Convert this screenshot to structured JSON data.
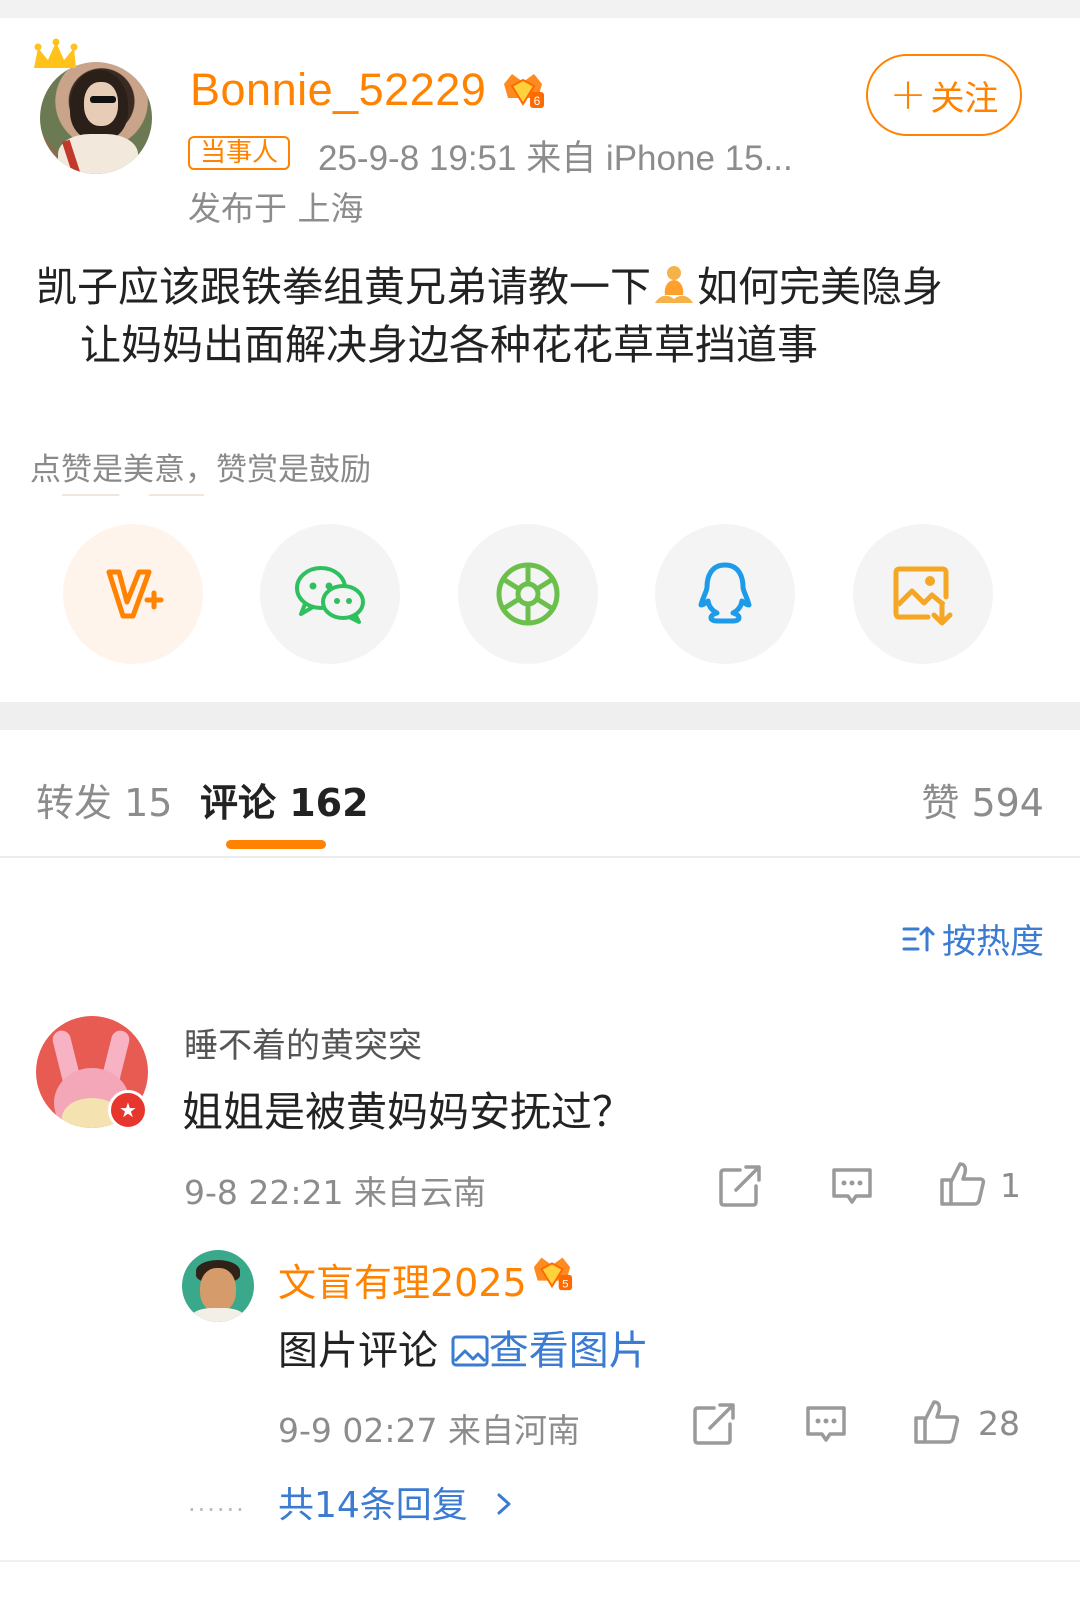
{
  "post": {
    "username": "Bonnie_52229",
    "tag": "当事人",
    "time_device": "25-9-8 19:51   来自 iPhone 15...",
    "location": "发布于 上海",
    "follow_label": "关注",
    "text_line1_a": "凯子应该跟铁拳组黄兄弟请教一下",
    "text_line1_b": "如何完美隐身",
    "text_line2": "让妈妈出面解决身边各种花花草草挡道事",
    "reward_hint": "点赞是美意，赞赏是鼓励"
  },
  "share_icons": [
    "v-plus-icon",
    "wechat-icon",
    "moments-icon",
    "qq-icon",
    "save-image-icon"
  ],
  "tabs": {
    "repost": "转发 15",
    "comment": "评论 162",
    "like": "赞 594"
  },
  "sort_label": "按热度",
  "comment": {
    "name": "睡不着的黄突突",
    "text": "姐姐是被黄妈妈安抚过？",
    "meta": "9-8 22:21  来自云南",
    "likes": "1"
  },
  "reply": {
    "name": "文盲有理2025",
    "text": "图片评论",
    "view_image": "查看图片",
    "meta": "9-9 02:27  来自河南",
    "likes": "28"
  },
  "more_replies": "共14条回复",
  "colors": {
    "accent": "#ff8200",
    "link": "#3b7bd1"
  }
}
